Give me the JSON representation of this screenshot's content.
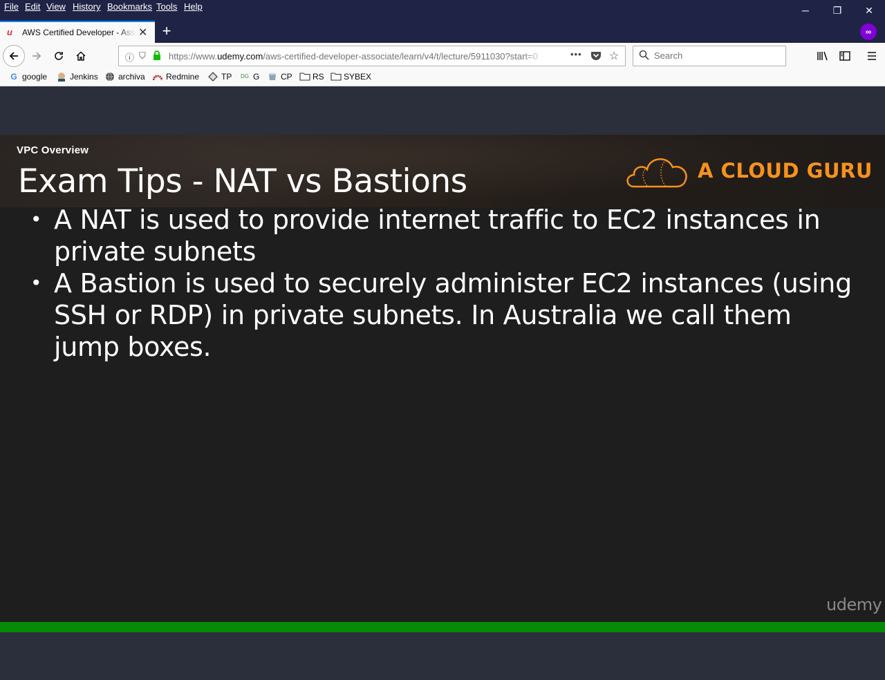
{
  "menu": [
    "File",
    "Edit",
    "View",
    "History",
    "Bookmarks",
    "Tools",
    "Help"
  ],
  "window_controls": {
    "minimize": "─",
    "restore": "❐",
    "close": "✕"
  },
  "tab": {
    "title": "AWS Certified Developer - Associate",
    "close": "✕"
  },
  "new_tab": "+",
  "url": {
    "prefix": "https://www.",
    "domain": "udemy.com",
    "path": "/aws-certified-developer-associate/learn/v4/t/lecture/5911030?start=0"
  },
  "search": {
    "placeholder": "Search"
  },
  "bookmarks": [
    {
      "label": "google",
      "icon": "google-icon"
    },
    {
      "label": "Jenkins",
      "icon": "jenkins-icon"
    },
    {
      "label": "archiva",
      "icon": "globe-icon"
    },
    {
      "label": "Redmine",
      "icon": "redmine-icon"
    },
    {
      "label": "TP",
      "icon": "tp-icon"
    },
    {
      "label": "G",
      "icon": "g-icon"
    },
    {
      "label": "CP",
      "icon": "cp-icon"
    },
    {
      "label": "RS",
      "icon": "folder-icon"
    },
    {
      "label": "SYBEX",
      "icon": "folder-icon"
    }
  ],
  "slide": {
    "section": "VPC Overview",
    "title": "Exam Tips - NAT vs Bastions",
    "brand": "A CLOUD GURU",
    "bullets": [
      "A NAT is used to provide internet traffic to EC2 instances in private subnets",
      "A Bastion is used to securely administer EC2 instances (using SSH or RDP) in private subnets. In Australia we call them jump boxes."
    ],
    "watermark": "udemy"
  },
  "player": {
    "progress_fraction": 1.0
  },
  "colors": {
    "accent": "#0a84ff",
    "brand": "#f6921e",
    "progress": "#078a08",
    "chrome_dark": "#1f2346"
  }
}
